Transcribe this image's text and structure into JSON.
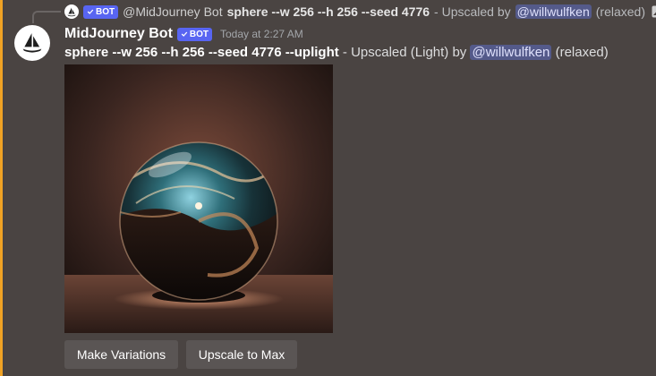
{
  "reply": {
    "badge_label": "BOT",
    "author": "@MidJourney Bot",
    "command": "sphere --w 256 --h 256 --seed 4776",
    "separator": " - Upscaled by",
    "mention": "@willwulfken",
    "suffix": "(relaxed)"
  },
  "message": {
    "username": "MidJourney Bot",
    "badge_label": "BOT",
    "timestamp": "Today at 2:27 AM",
    "command": "sphere --w 256 --h 256 --seed 4776 --uplight",
    "separator": " - Upscaled (Light) by ",
    "mention": "@willwulfken",
    "suffix": " (relaxed)"
  },
  "buttons": {
    "variations_label": "Make Variations",
    "upscale_label": "Upscale to Max"
  },
  "icons": {
    "reply_avatar": "sailboat-icon",
    "avatar": "sailboat-icon",
    "bot_badge_check": "checkmark-icon",
    "reply_image": "image-icon"
  },
  "colors": {
    "background": "#4a4442",
    "accent_bar": "#f0a224",
    "badge": "#5865f2",
    "mention_bg": "#545a8a",
    "button_bg": "#5a5554"
  }
}
